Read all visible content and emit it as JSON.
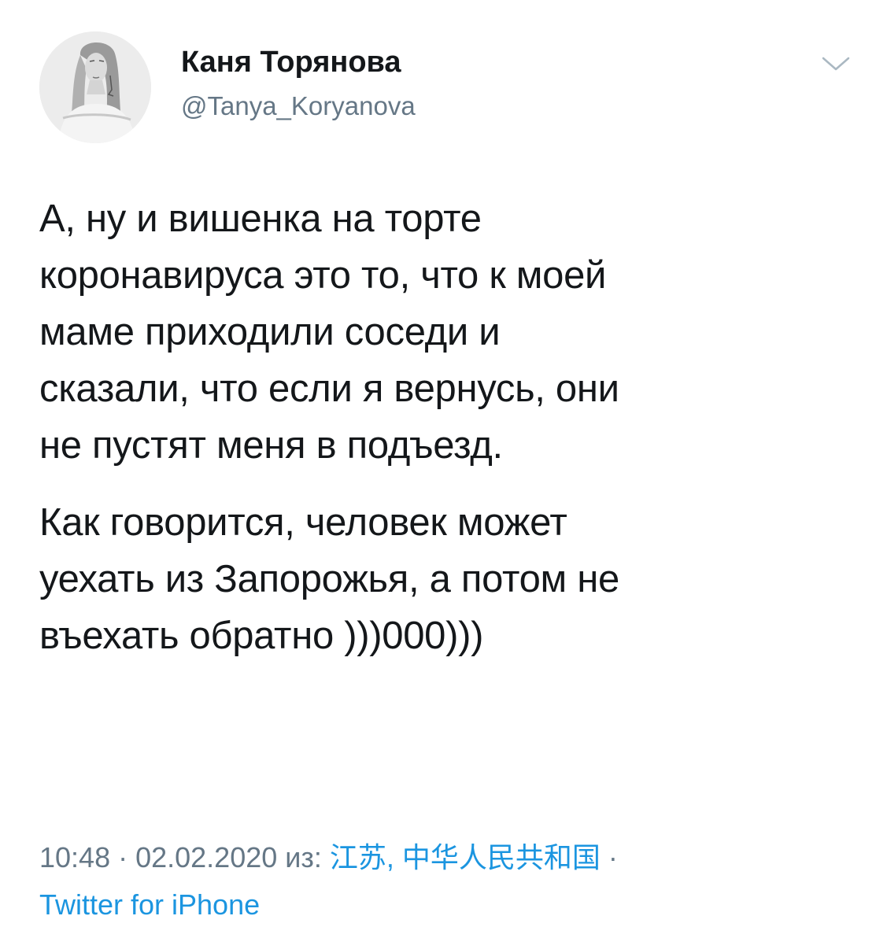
{
  "tweet": {
    "author": {
      "display_name": "Каня Торянова",
      "handle": "@Tanya_Koryanova"
    },
    "caret_icon": "chevron-down-icon",
    "paragraphs": [
      "А, ну и вишенка на торте\nкоронавируса это то, что к моей\nмаме приходили соседи и\nсказали, что если я вернусь, они\nне пустят меня в подъезд.",
      "Как говорится, человек может\nуехать из Запорожья, а потом не\nвъехать обратно )))000)))"
    ],
    "meta": {
      "time": "10:48",
      "sep1": " · ",
      "date": "02.02.2020",
      "from_label": " из: ",
      "location": "江苏, 中华人民共和国",
      "sep2": " · ",
      "source": "Twitter for iPhone"
    },
    "colors": {
      "text": "#14171a",
      "secondary": "#657786",
      "link": "#1b95e0"
    }
  }
}
